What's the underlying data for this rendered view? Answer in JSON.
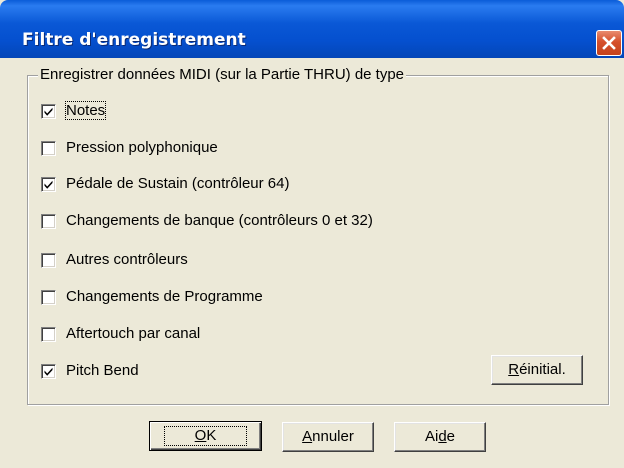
{
  "window": {
    "title": "Filtre d'enregistrement"
  },
  "group": {
    "legend": "Enregistrer données MIDI (sur la Partie THRU) de type"
  },
  "checkboxes": [
    {
      "label": "Notes",
      "checked": true
    },
    {
      "label": "Pression polyphonique",
      "checked": false
    },
    {
      "label": "Pédale de Sustain (contrôleur 64)",
      "checked": true
    },
    {
      "label": "Changements de banque (contrôleurs 0 et 32)",
      "checked": false
    },
    {
      "label": "Autres contrôleurs",
      "checked": false
    },
    {
      "label": "Changements de Programme",
      "checked": false
    },
    {
      "label": "Aftertouch par canal",
      "checked": false
    },
    {
      "label": "Pitch Bend",
      "checked": true
    }
  ],
  "buttons": {
    "reset": {
      "mnemonic": "R",
      "rest": "éinitial."
    },
    "ok": {
      "mnemonic": "O",
      "rest": "K"
    },
    "cancel": {
      "mnemonic": "A",
      "rest": "nnuler"
    },
    "help": {
      "before": "Ai",
      "mnemonic": "d",
      "after": "e"
    }
  },
  "colors": {
    "titlebar": "#0a58d6",
    "close": "#d5502c",
    "dialog": "#ece9d8"
  }
}
